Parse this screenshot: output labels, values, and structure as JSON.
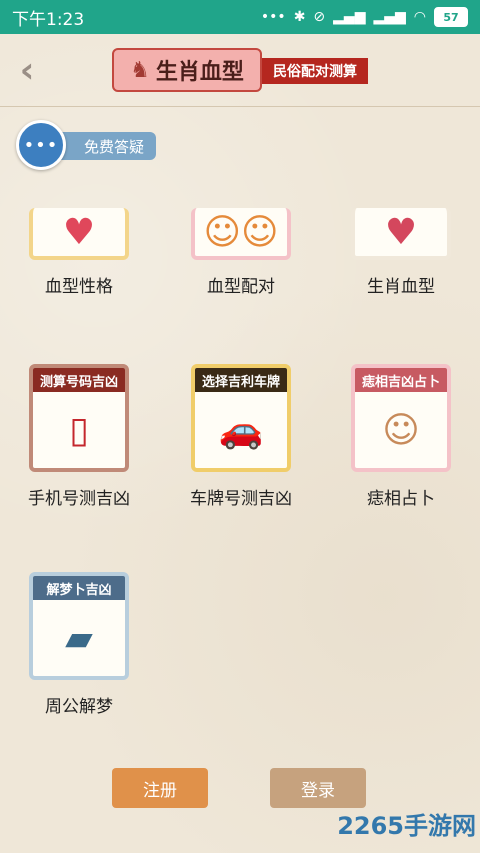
{
  "status": {
    "time": "下午1:23",
    "battery": "57"
  },
  "header": {
    "title": "生肖血型",
    "subtitle": "民俗配对测算"
  },
  "faq": {
    "label": "免费答疑"
  },
  "grid": {
    "row1": [
      {
        "label": "血型性格"
      },
      {
        "label": "血型配对"
      },
      {
        "label": "生肖血型"
      }
    ],
    "row2": [
      {
        "banner": "测算号码吉凶",
        "label": "手机号测吉凶"
      },
      {
        "banner": "选择吉利车牌",
        "label": "车牌号测吉凶"
      },
      {
        "banner": "痣相吉凶占卜",
        "label": "痣相占卜"
      }
    ],
    "row3": [
      {
        "banner": "解梦卜吉凶",
        "label": "周公解梦"
      }
    ]
  },
  "buttons": {
    "register": "注册",
    "login": "登录"
  },
  "watermark": "2265手游网"
}
